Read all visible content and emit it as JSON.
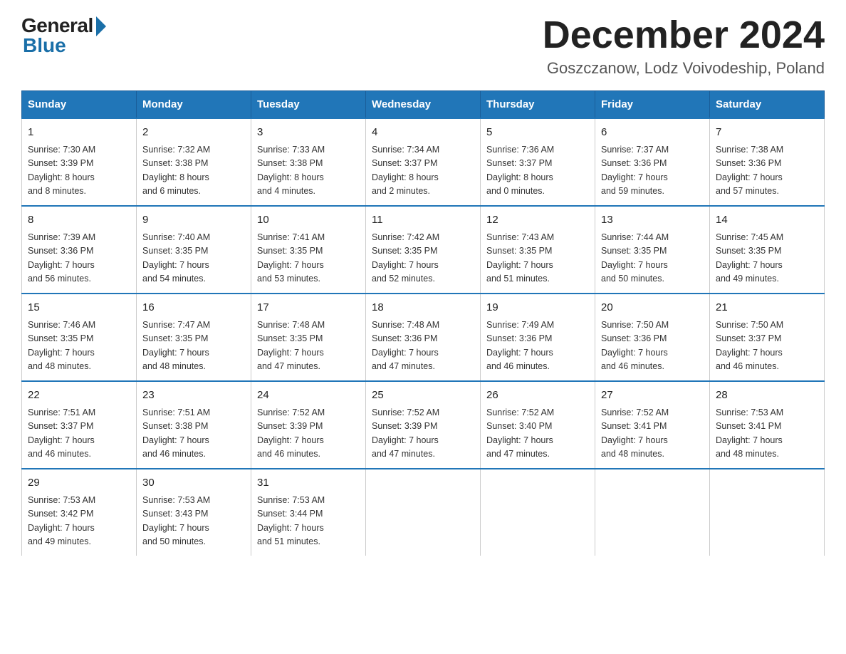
{
  "logo": {
    "general": "General",
    "blue": "Blue"
  },
  "title": "December 2024",
  "subtitle": "Goszczanow, Lodz Voivodeship, Poland",
  "days_of_week": [
    "Sunday",
    "Monday",
    "Tuesday",
    "Wednesday",
    "Thursday",
    "Friday",
    "Saturday"
  ],
  "weeks": [
    [
      {
        "day": "1",
        "info": "Sunrise: 7:30 AM\nSunset: 3:39 PM\nDaylight: 8 hours\nand 8 minutes."
      },
      {
        "day": "2",
        "info": "Sunrise: 7:32 AM\nSunset: 3:38 PM\nDaylight: 8 hours\nand 6 minutes."
      },
      {
        "day": "3",
        "info": "Sunrise: 7:33 AM\nSunset: 3:38 PM\nDaylight: 8 hours\nand 4 minutes."
      },
      {
        "day": "4",
        "info": "Sunrise: 7:34 AM\nSunset: 3:37 PM\nDaylight: 8 hours\nand 2 minutes."
      },
      {
        "day": "5",
        "info": "Sunrise: 7:36 AM\nSunset: 3:37 PM\nDaylight: 8 hours\nand 0 minutes."
      },
      {
        "day": "6",
        "info": "Sunrise: 7:37 AM\nSunset: 3:36 PM\nDaylight: 7 hours\nand 59 minutes."
      },
      {
        "day": "7",
        "info": "Sunrise: 7:38 AM\nSunset: 3:36 PM\nDaylight: 7 hours\nand 57 minutes."
      }
    ],
    [
      {
        "day": "8",
        "info": "Sunrise: 7:39 AM\nSunset: 3:36 PM\nDaylight: 7 hours\nand 56 minutes."
      },
      {
        "day": "9",
        "info": "Sunrise: 7:40 AM\nSunset: 3:35 PM\nDaylight: 7 hours\nand 54 minutes."
      },
      {
        "day": "10",
        "info": "Sunrise: 7:41 AM\nSunset: 3:35 PM\nDaylight: 7 hours\nand 53 minutes."
      },
      {
        "day": "11",
        "info": "Sunrise: 7:42 AM\nSunset: 3:35 PM\nDaylight: 7 hours\nand 52 minutes."
      },
      {
        "day": "12",
        "info": "Sunrise: 7:43 AM\nSunset: 3:35 PM\nDaylight: 7 hours\nand 51 minutes."
      },
      {
        "day": "13",
        "info": "Sunrise: 7:44 AM\nSunset: 3:35 PM\nDaylight: 7 hours\nand 50 minutes."
      },
      {
        "day": "14",
        "info": "Sunrise: 7:45 AM\nSunset: 3:35 PM\nDaylight: 7 hours\nand 49 minutes."
      }
    ],
    [
      {
        "day": "15",
        "info": "Sunrise: 7:46 AM\nSunset: 3:35 PM\nDaylight: 7 hours\nand 48 minutes."
      },
      {
        "day": "16",
        "info": "Sunrise: 7:47 AM\nSunset: 3:35 PM\nDaylight: 7 hours\nand 48 minutes."
      },
      {
        "day": "17",
        "info": "Sunrise: 7:48 AM\nSunset: 3:35 PM\nDaylight: 7 hours\nand 47 minutes."
      },
      {
        "day": "18",
        "info": "Sunrise: 7:48 AM\nSunset: 3:36 PM\nDaylight: 7 hours\nand 47 minutes."
      },
      {
        "day": "19",
        "info": "Sunrise: 7:49 AM\nSunset: 3:36 PM\nDaylight: 7 hours\nand 46 minutes."
      },
      {
        "day": "20",
        "info": "Sunrise: 7:50 AM\nSunset: 3:36 PM\nDaylight: 7 hours\nand 46 minutes."
      },
      {
        "day": "21",
        "info": "Sunrise: 7:50 AM\nSunset: 3:37 PM\nDaylight: 7 hours\nand 46 minutes."
      }
    ],
    [
      {
        "day": "22",
        "info": "Sunrise: 7:51 AM\nSunset: 3:37 PM\nDaylight: 7 hours\nand 46 minutes."
      },
      {
        "day": "23",
        "info": "Sunrise: 7:51 AM\nSunset: 3:38 PM\nDaylight: 7 hours\nand 46 minutes."
      },
      {
        "day": "24",
        "info": "Sunrise: 7:52 AM\nSunset: 3:39 PM\nDaylight: 7 hours\nand 46 minutes."
      },
      {
        "day": "25",
        "info": "Sunrise: 7:52 AM\nSunset: 3:39 PM\nDaylight: 7 hours\nand 47 minutes."
      },
      {
        "day": "26",
        "info": "Sunrise: 7:52 AM\nSunset: 3:40 PM\nDaylight: 7 hours\nand 47 minutes."
      },
      {
        "day": "27",
        "info": "Sunrise: 7:52 AM\nSunset: 3:41 PM\nDaylight: 7 hours\nand 48 minutes."
      },
      {
        "day": "28",
        "info": "Sunrise: 7:53 AM\nSunset: 3:41 PM\nDaylight: 7 hours\nand 48 minutes."
      }
    ],
    [
      {
        "day": "29",
        "info": "Sunrise: 7:53 AM\nSunset: 3:42 PM\nDaylight: 7 hours\nand 49 minutes."
      },
      {
        "day": "30",
        "info": "Sunrise: 7:53 AM\nSunset: 3:43 PM\nDaylight: 7 hours\nand 50 minutes."
      },
      {
        "day": "31",
        "info": "Sunrise: 7:53 AM\nSunset: 3:44 PM\nDaylight: 7 hours\nand 51 minutes."
      },
      {
        "day": "",
        "info": ""
      },
      {
        "day": "",
        "info": ""
      },
      {
        "day": "",
        "info": ""
      },
      {
        "day": "",
        "info": ""
      }
    ]
  ]
}
